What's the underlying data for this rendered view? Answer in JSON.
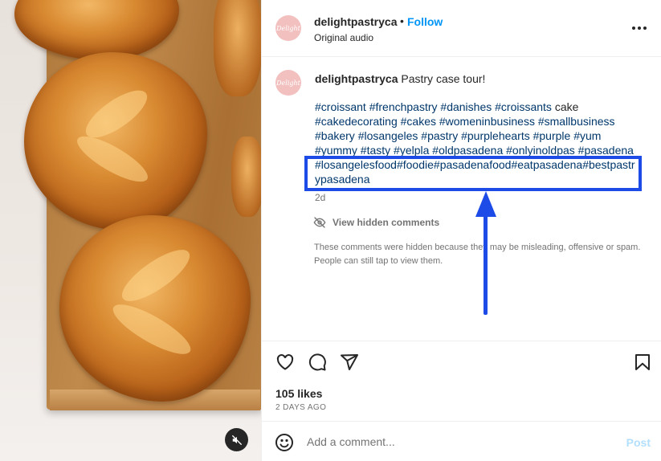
{
  "post": {
    "username": "delightpastryca",
    "separator": "•",
    "follow_label": "Follow",
    "audio_label": "Original audio",
    "avatar_text": "Delight",
    "more_icon": "more-options-icon"
  },
  "caption": {
    "username": "delightpastryca",
    "text": " Pastry case tour!",
    "tag_lines": [
      {
        "a": "#croissant #frenchpastry #danishes #croissants",
        "b": " cake"
      },
      {
        "a": "#cakedecorating #cakes #womeninbusiness #smallbusiness",
        "b": ""
      },
      {
        "a": "#bakery #losangeles #pastry #purplehearts #purple #yum",
        "b": ""
      },
      {
        "a": "#yummy #tasty #yelpla #oldpasadena #onlyinoldpas #pasadena",
        "b": ""
      },
      {
        "a": "#losangelesfood#foodie#pasadenafood#eatpasadena#bestpastr",
        "b": ""
      },
      {
        "a": "ypasadena",
        "b": ""
      }
    ],
    "age": "2d"
  },
  "hidden_comments": {
    "label": "View hidden comments",
    "note": "These comments were hidden because they may be misleading, offensive or spam. People can still tap to view them."
  },
  "actions": {
    "likes": "105 likes",
    "posted": "2 DAYS AGO",
    "icons": [
      "heart-icon",
      "comment-icon",
      "share-icon",
      "bookmark-icon"
    ]
  },
  "comment": {
    "placeholder": "Add a comment...",
    "post_label": "Post"
  },
  "colors": {
    "accent": "#0095f6",
    "hashtag": "#00376b",
    "annotation": "#1d4be8",
    "post_disabled": "#b2dffc"
  }
}
